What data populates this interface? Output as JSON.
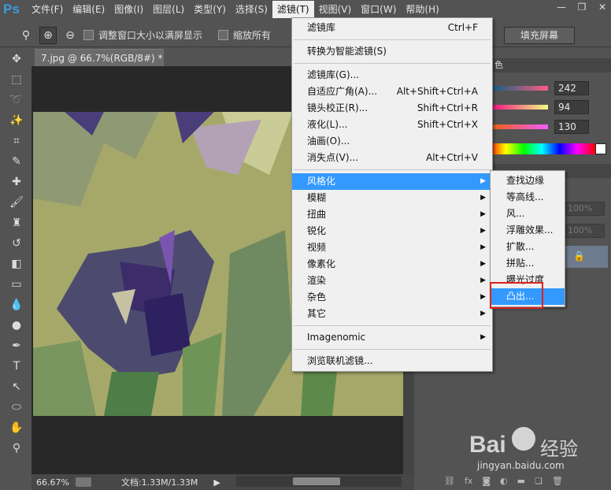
{
  "menubar": {
    "logo": "Ps",
    "items": [
      "文件(F)",
      "编辑(E)",
      "图像(I)",
      "图层(L)",
      "类型(Y)",
      "选择(S)",
      "滤镜(T)",
      "视图(V)",
      "窗口(W)",
      "帮助(H)"
    ],
    "active_index": 6
  },
  "options": {
    "resize_windows_label": "调整窗口大小以满屏显示",
    "zoom_all_label": "缩放所有",
    "fill_screen_label": "填充屏幕"
  },
  "document": {
    "tab_title": "7.jpg @ 66.7%(RGB/8#) *",
    "zoom": "66.67%",
    "doc_size": "文档:1.33M/1.33M"
  },
  "color_panel": {
    "title_fragment": "色",
    "r": "242",
    "g": "94",
    "b": "130",
    "opacity_placeholder": "100%",
    "fill_placeholder": "100%"
  },
  "filter_menu": {
    "items": [
      {
        "label": "滤镜库",
        "shortcut": "Ctrl+F"
      },
      {
        "label": "转换为智能滤镜(S)",
        "shortcut": ""
      },
      {
        "label": "滤镜库(G)...",
        "shortcut": ""
      },
      {
        "label": "自适应广角(A)...",
        "shortcut": "Alt+Shift+Ctrl+A"
      },
      {
        "label": "镜头校正(R)...",
        "shortcut": "Shift+Ctrl+R"
      },
      {
        "label": "液化(L)...",
        "shortcut": "Shift+Ctrl+X"
      },
      {
        "label": "油画(O)...",
        "shortcut": ""
      },
      {
        "label": "消失点(V)...",
        "shortcut": "Alt+Ctrl+V"
      },
      {
        "label": "风格化",
        "shortcut": ""
      },
      {
        "label": "模糊",
        "shortcut": ""
      },
      {
        "label": "扭曲",
        "shortcut": ""
      },
      {
        "label": "锐化",
        "shortcut": ""
      },
      {
        "label": "视频",
        "shortcut": ""
      },
      {
        "label": "像素化",
        "shortcut": ""
      },
      {
        "label": "渲染",
        "shortcut": ""
      },
      {
        "label": "杂色",
        "shortcut": ""
      },
      {
        "label": "其它",
        "shortcut": ""
      },
      {
        "label": "Imagenomic",
        "shortcut": ""
      },
      {
        "label": "浏览联机滤镜...",
        "shortcut": ""
      }
    ]
  },
  "stylize_submenu": {
    "items": [
      "查找边缘",
      "等高线...",
      "风...",
      "浮雕效果...",
      "扩散...",
      "拼贴...",
      "曝光过度",
      "凸出..."
    ],
    "highlighted_index": 7
  },
  "watermark": {
    "brand": "Bai",
    "brand_cn": "经验",
    "url": "jingyan.baidu.com"
  }
}
